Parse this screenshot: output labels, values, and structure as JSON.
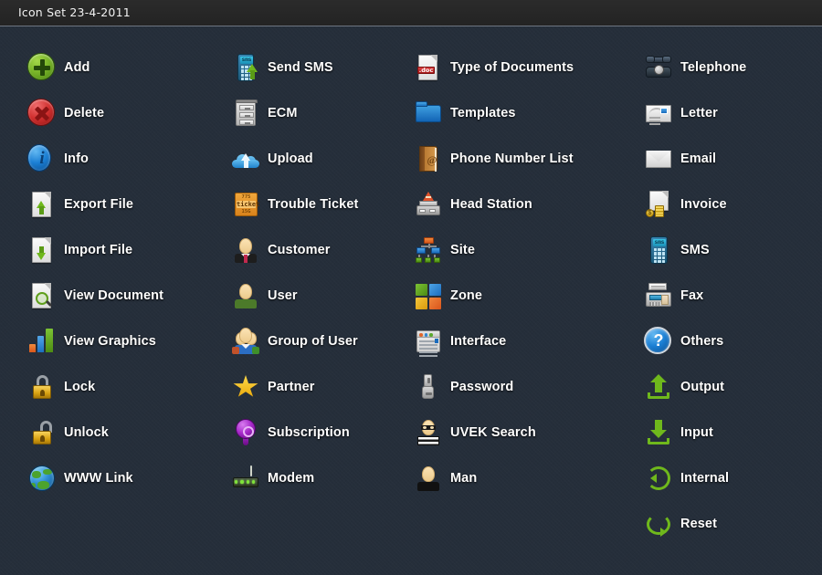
{
  "titlebar": {
    "title": "Icon Set 23-4-2011"
  },
  "theme": {
    "background": "#252e3a",
    "titlebar_background": "#262626",
    "label_color": "#ffffff",
    "accent_green": "#6fb81c",
    "accent_blue": "#1b7fd4",
    "accent_red": "#d1302f",
    "accent_orange": "#d9831c"
  },
  "columns": [
    {
      "items": [
        {
          "label": "Add",
          "icon": "add-icon"
        },
        {
          "label": "Delete",
          "icon": "delete-icon"
        },
        {
          "label": "Info",
          "icon": "info-icon"
        },
        {
          "label": "Export File",
          "icon": "export-file-icon"
        },
        {
          "label": "Import File",
          "icon": "import-file-icon"
        },
        {
          "label": "View Document",
          "icon": "view-document-icon"
        },
        {
          "label": "View Graphics",
          "icon": "view-graphics-icon"
        },
        {
          "label": "Lock",
          "icon": "lock-icon"
        },
        {
          "label": "Unlock",
          "icon": "unlock-icon"
        },
        {
          "label": "WWW Link",
          "icon": "www-link-icon"
        }
      ]
    },
    {
      "items": [
        {
          "label": "Send SMS",
          "icon": "send-sms-icon"
        },
        {
          "label": "ECM",
          "icon": "ecm-icon"
        },
        {
          "label": "Upload",
          "icon": "upload-icon"
        },
        {
          "label": "Trouble Ticket",
          "icon": "trouble-ticket-icon",
          "ticket_text": {
            "top": "775",
            "middle": "ticket",
            "bottom": "15G"
          }
        },
        {
          "label": "Customer",
          "icon": "customer-icon"
        },
        {
          "label": "User",
          "icon": "user-icon"
        },
        {
          "label": "Group of User",
          "icon": "group-of-user-icon"
        },
        {
          "label": "Partner",
          "icon": "partner-icon"
        },
        {
          "label": "Subscription",
          "icon": "subscription-icon"
        },
        {
          "label": "Modem",
          "icon": "modem-icon"
        }
      ]
    },
    {
      "items": [
        {
          "label": "Type of Documents",
          "icon": "type-of-documents-icon",
          "doc_tag": ".doc"
        },
        {
          "label": "Templates",
          "icon": "templates-icon"
        },
        {
          "label": "Phone Number List",
          "icon": "phone-number-list-icon",
          "book_glyph": "@"
        },
        {
          "label": "Head Station",
          "icon": "head-station-icon"
        },
        {
          "label": "Site",
          "icon": "site-icon"
        },
        {
          "label": "Zone",
          "icon": "zone-icon"
        },
        {
          "label": "Interface",
          "icon": "interface-icon"
        },
        {
          "label": "Password",
          "icon": "password-icon"
        },
        {
          "label": "UVEK Search",
          "icon": "uvek-search-icon"
        },
        {
          "label": "Man",
          "icon": "man-icon"
        }
      ]
    },
    {
      "items": [
        {
          "label": "Telephone",
          "icon": "telephone-icon"
        },
        {
          "label": "Letter",
          "icon": "letter-icon"
        },
        {
          "label": "Email",
          "icon": "email-icon"
        },
        {
          "label": "Invoice",
          "icon": "invoice-icon",
          "currency_glyph": "$"
        },
        {
          "label": "SMS",
          "icon": "sms-icon",
          "screen_text": "sms"
        },
        {
          "label": "Fax",
          "icon": "fax-icon"
        },
        {
          "label": "Others",
          "icon": "others-icon",
          "glyph": "?"
        },
        {
          "label": "Output",
          "icon": "output-icon"
        },
        {
          "label": "Input",
          "icon": "input-icon"
        },
        {
          "label": "Internal",
          "icon": "internal-icon"
        },
        {
          "label": "Reset",
          "icon": "reset-icon"
        }
      ]
    }
  ]
}
